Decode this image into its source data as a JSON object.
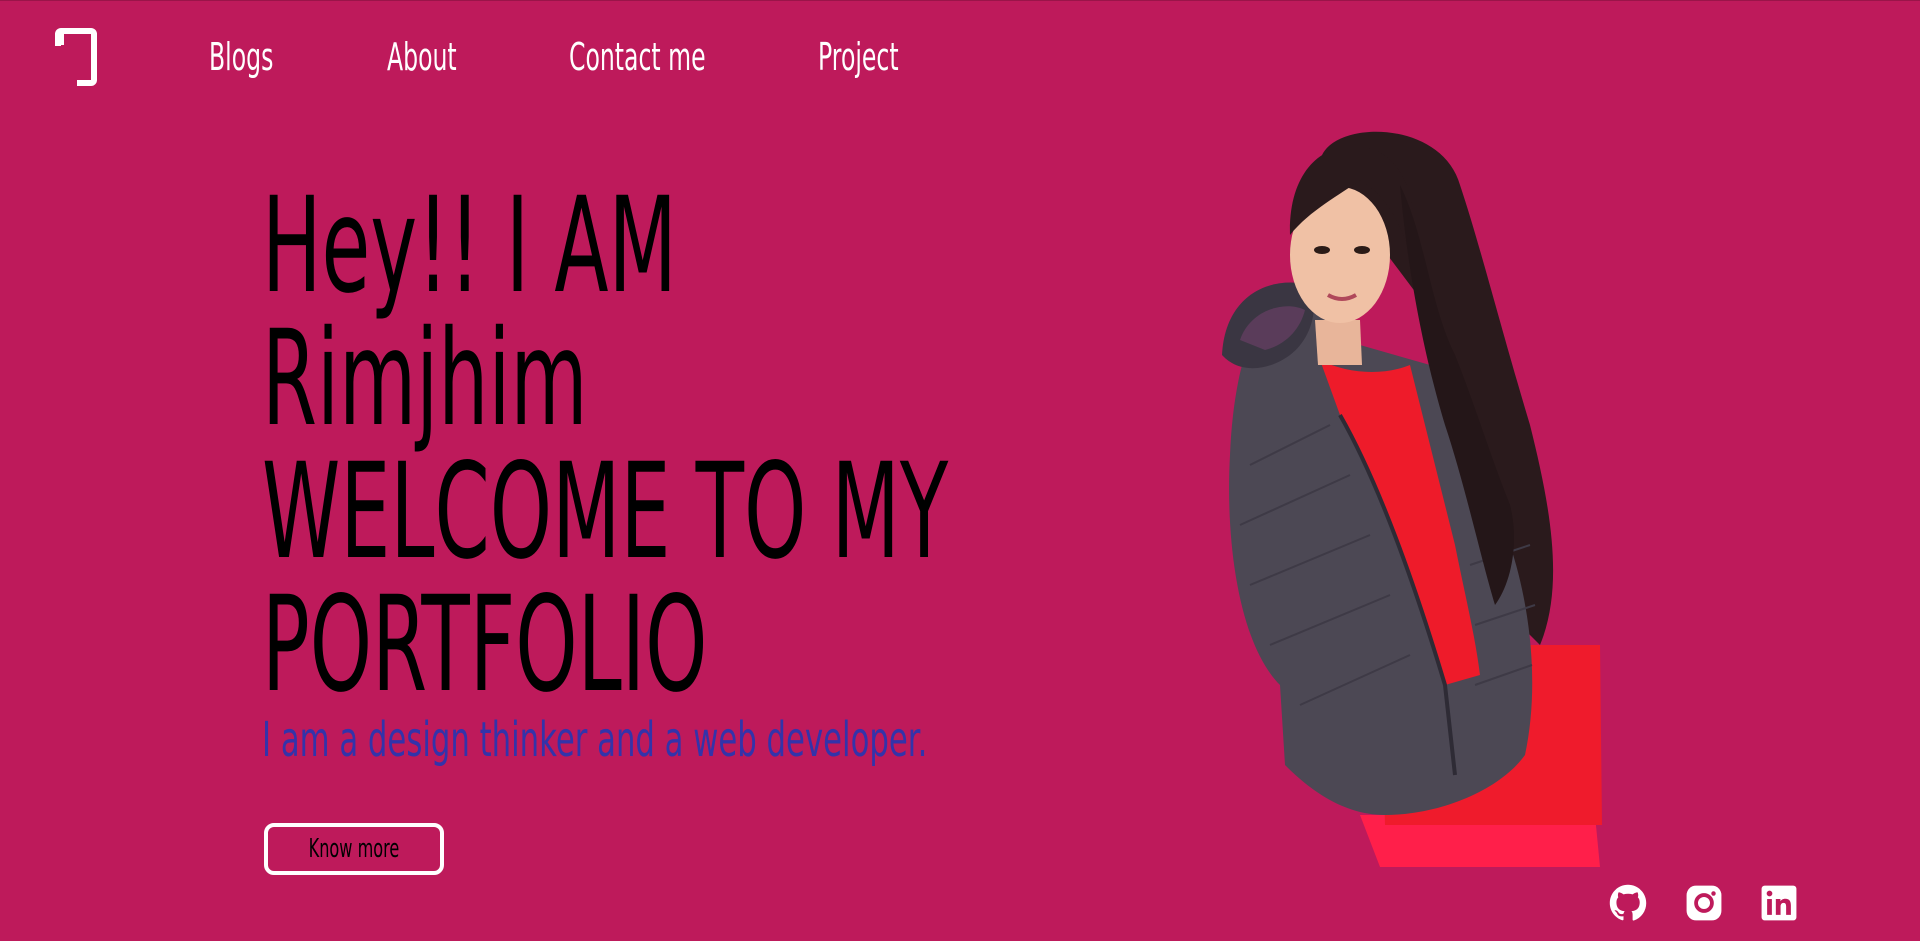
{
  "colors": {
    "background": "#be1a5b",
    "nav_text": "#ffffff",
    "heading_text": "#000000",
    "tagline_text": "#3333aa",
    "button_border": "#ffffff"
  },
  "logo": {
    "icon": "logo-mark-icon"
  },
  "nav": {
    "items": [
      {
        "label": "Blogs"
      },
      {
        "label": "About"
      },
      {
        "label": "Contact me"
      },
      {
        "label": "Project"
      }
    ]
  },
  "hero": {
    "lines": [
      "Hey!! I AM",
      "Rimjhim",
      "WELCOME TO MY",
      "PORTFOLIO"
    ],
    "tagline": "I am a design thinker and a web developer.",
    "cta_label": "Know more"
  },
  "portrait": {
    "icon": "profile-photo"
  },
  "social": [
    {
      "icon": "github-icon"
    },
    {
      "icon": "instagram-icon"
    },
    {
      "icon": "linkedin-icon"
    }
  ]
}
